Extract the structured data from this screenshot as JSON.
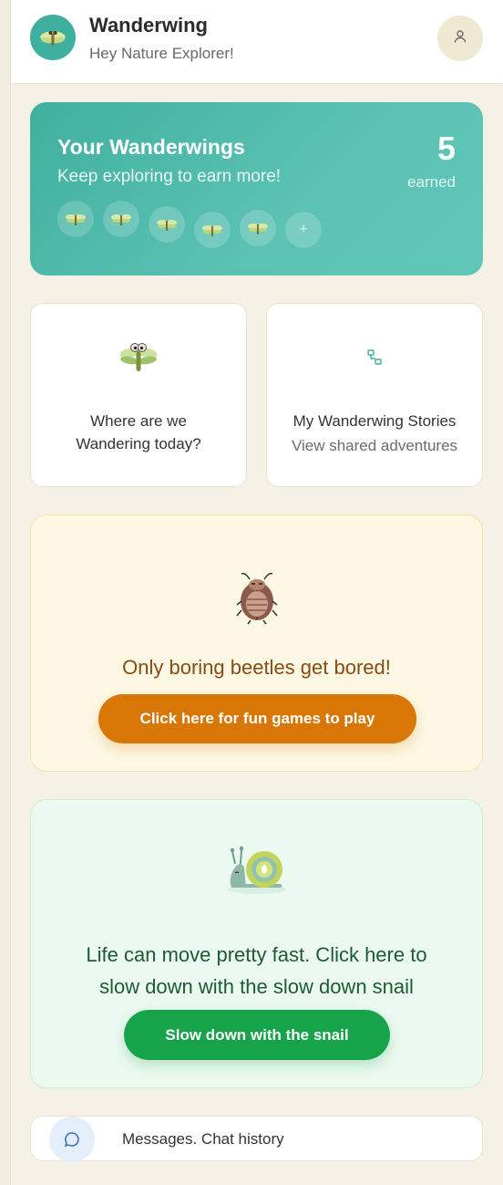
{
  "header": {
    "app_title": "Wanderwing",
    "greeting": "Hey Nature Explorer!",
    "logo_icon": "dragonfly-icon",
    "profile_icon": "user-icon"
  },
  "wanderwings": {
    "title": "Your Wanderwings",
    "subtitle": "Keep exploring to earn more!",
    "count": "5",
    "count_label": "earned",
    "earned_slots": 5,
    "add_slot_label": "+"
  },
  "tiles": {
    "wander": {
      "label": "Where are we Wandering today?",
      "icon": "dragonfly-icon"
    },
    "stories": {
      "label": "My Wanderwing Stories",
      "sub": "View shared adventures",
      "icon": "link-nodes-icon"
    }
  },
  "beetle": {
    "text": "Only boring beetles get bored!",
    "button": "Click here for fun games to play",
    "icon": "beetle-icon"
  },
  "snail": {
    "text": "Life can move pretty fast. Click here to slow down with the slow down snail",
    "button": "Slow down with the snail",
    "icon": "snail-icon"
  },
  "messages": {
    "label": "Messages. Chat history",
    "icon": "chat-bubble-icon"
  },
  "colors": {
    "teal": "#3fb09f",
    "orange": "#d97706",
    "green": "#16a34a",
    "beetle_text": "#8a4a13",
    "snail_text": "#1c5b33"
  }
}
